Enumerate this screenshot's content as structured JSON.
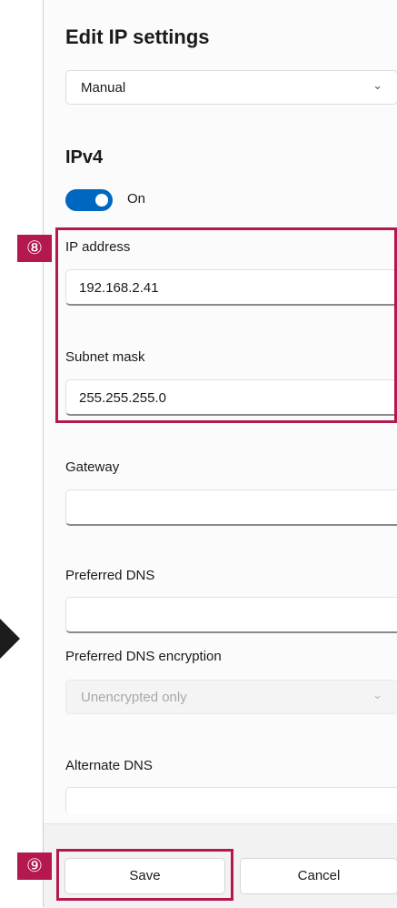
{
  "dialog": {
    "title": "Edit IP settings",
    "mode_dropdown": {
      "value": "Manual"
    }
  },
  "ipv4": {
    "title": "IPv4",
    "toggle_label": "On",
    "toggle_state": true
  },
  "fields": {
    "ip_address": {
      "label": "IP address",
      "value": "192.168.2.41"
    },
    "subnet_mask": {
      "label": "Subnet mask",
      "value": "255.255.255.0"
    },
    "gateway": {
      "label": "Gateway",
      "value": ""
    },
    "preferred_dns": {
      "label": "Preferred DNS",
      "value": ""
    },
    "preferred_dns_encryption": {
      "label": "Preferred DNS encryption",
      "value": "Unencrypted only"
    },
    "alternate_dns": {
      "label": "Alternate DNS",
      "value": ""
    }
  },
  "footer": {
    "save_label": "Save",
    "cancel_label": "Cancel"
  },
  "annotations": {
    "badge_8": "⑧",
    "badge_9": "⑨"
  },
  "colors": {
    "accent": "#0067c0",
    "highlight": "#b5174f"
  }
}
